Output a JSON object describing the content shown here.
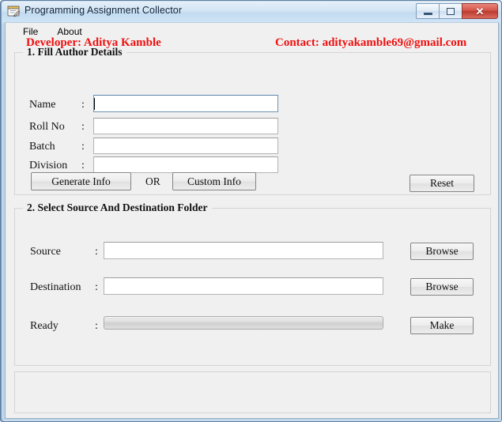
{
  "window": {
    "title": "Programming Assignment Collector",
    "icon": "form-pencil-icon",
    "caption_buttons": {
      "minimize": "minimize-icon",
      "maximize": "maximize-icon",
      "close": "✕"
    }
  },
  "menubar": {
    "items": [
      {
        "label": "File"
      },
      {
        "label": "About"
      }
    ]
  },
  "author_group": {
    "title": "1. Fill Author Details",
    "fields": [
      {
        "label": "Name",
        "separator": ":",
        "value": "",
        "placeholder": "",
        "focused": true
      },
      {
        "label": "Roll No",
        "separator": ":",
        "value": "",
        "placeholder": "",
        "focused": false
      },
      {
        "label": "Batch",
        "separator": ":",
        "value": "",
        "placeholder": "",
        "focused": false
      },
      {
        "label": "Division",
        "separator": ":",
        "value": "",
        "placeholder": "",
        "focused": false
      }
    ],
    "generate_button": "Generate Info",
    "or_text": "OR",
    "custom_button": "Custom Info",
    "reset_button": "Reset"
  },
  "folder_group": {
    "title": "2. Select Source And Destination Folder",
    "rows": [
      {
        "label": "Source",
        "separator": ":",
        "value": "",
        "button": "Browse"
      },
      {
        "label": "Destination",
        "separator": ":",
        "value": "",
        "button": "Browse"
      }
    ],
    "status_label": "Ready",
    "status_separator": ":",
    "progress_percent": 0,
    "make_button": "Make"
  },
  "footer": {
    "developer": "Developer: Aditya Kamble",
    "contact": "Contact: adityakamble69@gmail.com",
    "color": "#f01010"
  }
}
